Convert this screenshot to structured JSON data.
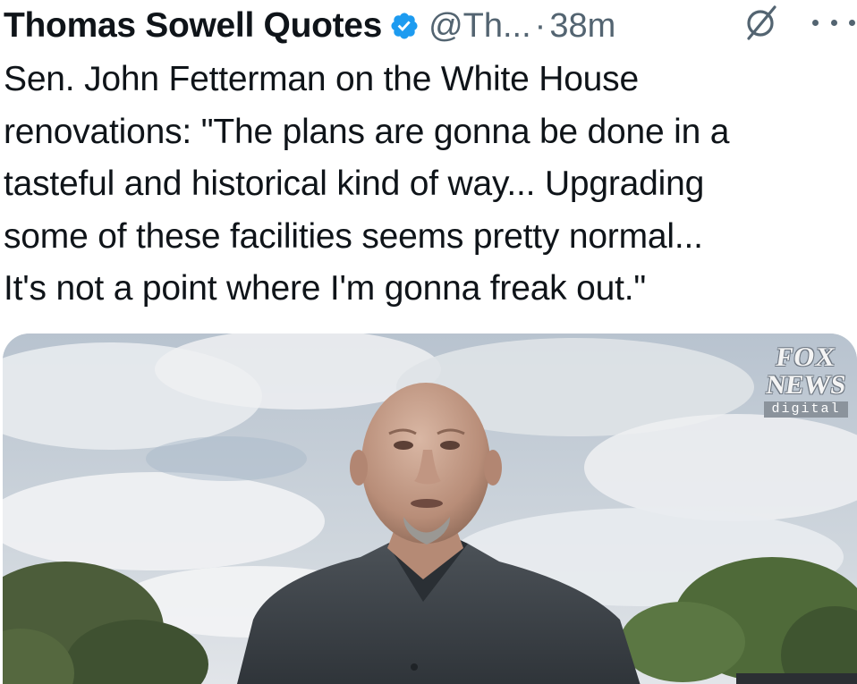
{
  "tweet": {
    "display_name": "Thomas Sowell Quotes",
    "handle": "@Th...",
    "separator": "·",
    "time": "38m",
    "lines": [
      "Sen. John Fetterman on the White House",
      "renovations: \"The plans are gonna be done in a",
      "tasteful and historical kind of way... Upgrading",
      "some of these facilities seems pretty normal...",
      "It's not a point where I'm gonna freak out.\""
    ]
  },
  "media": {
    "watermark": {
      "line1": "FOX",
      "line2": "NEWS",
      "line3": "digital"
    }
  },
  "icons": {
    "verified": "verified-badge-icon",
    "grok": "grok-icon",
    "more": "more-horizontal-icon"
  },
  "colors": {
    "text": "#0f1419",
    "secondary": "#536471",
    "verified": "#1d9bf0"
  }
}
